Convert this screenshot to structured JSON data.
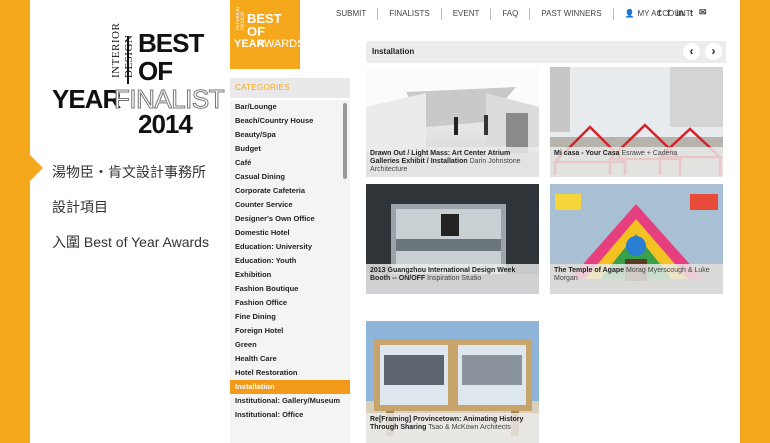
{
  "left": {
    "brand": {
      "interior_design": "INTERIOR DESIGN",
      "best": "BEST",
      "of": "OF",
      "year": "YEAR",
      "finalist": "FINALIST",
      "year_num": "2014"
    },
    "firm_lines": [
      "湯物臣・肯文設計事務所",
      "設計項目",
      "入圍 Best of Year Awards"
    ]
  },
  "logo": {
    "interior_design": "INTERIOR DESIGN",
    "best_of": "BEST OF",
    "year": "YEAR",
    "awards": "AWARDS"
  },
  "topnav": {
    "submit": "SUBMIT",
    "finalists": "FINALISTS",
    "event": "EVENT",
    "faq": "FAQ",
    "past_winners": "PAST WINNERS",
    "my_account": "MY ACCOUNT"
  },
  "social": {
    "twitter": "t",
    "facebook": "f",
    "linkedin": "in",
    "tumblr": "t",
    "email": "✉"
  },
  "categories": {
    "header": "CATEGORIES",
    "items": [
      "Bar/Lounge",
      "Beach/Country House",
      "Beauty/Spa",
      "Budget",
      "Café",
      "Casual Dining",
      "Corporate Cafeteria",
      "Counter Service",
      "Designer's Own Office",
      "Domestic Hotel",
      "Education: University",
      "Education: Youth",
      "Exhibition",
      "Fashion Boutique",
      "Fashion Office",
      "Fine Dining",
      "Foreign Hotel",
      "Green",
      "Health Care",
      "Hotel Restoration",
      "Installation",
      "Institutional: Gallery/Museum",
      "Institutional: Office"
    ],
    "active": "Installation"
  },
  "content": {
    "breadcrumb": "Installation",
    "prev": "‹",
    "next": "›",
    "tiles": [
      {
        "title": "Drawn Out / Light Mass: Art Center Atrium Galleries Exhibit / Installation",
        "firm": "Darin Johnstone Architecture"
      },
      {
        "title": "Mi casa - Your Casa",
        "firm": "Esrawe + Cadena"
      },
      {
        "title": "2013 Guangzhou International Design Week Booth -- ON/OFF",
        "firm": "Inspiration Studio"
      },
      {
        "title": "The Temple of Agape",
        "firm": "Morag Myerscough & Luke Morgan"
      },
      {
        "title": "Re[Framing] Provincetown: Animating History Through Sharing",
        "firm": "Tsao & McKown Architects"
      }
    ]
  },
  "colors": {
    "accent": "#f6a81d",
    "active_category": "#f39a1a"
  }
}
